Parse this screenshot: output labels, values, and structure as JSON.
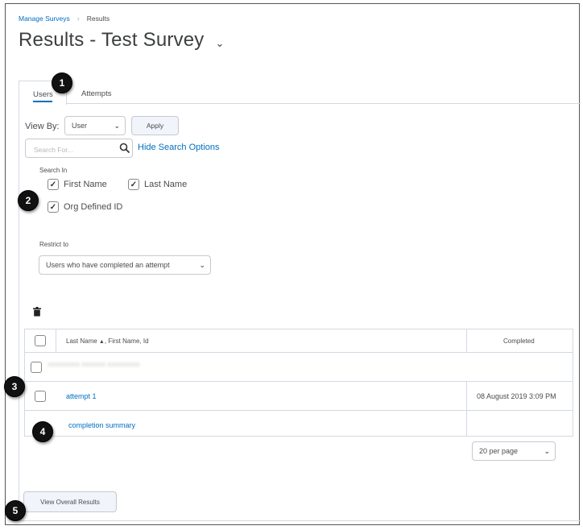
{
  "breadcrumb": {
    "parent": "Manage Surveys",
    "separator": "›",
    "current": "Results"
  },
  "page_title": "Results - Test Survey",
  "tabs": [
    {
      "label": "Users",
      "active": true
    },
    {
      "label": "Attempts",
      "active": false
    }
  ],
  "view_by": {
    "label": "View By:",
    "selected": "User",
    "apply_label": "Apply"
  },
  "search": {
    "placeholder": "Search For...",
    "hide_options_label": "Hide Search Options"
  },
  "search_in": {
    "label": "Search In",
    "options": [
      {
        "label": "First Name",
        "checked": true
      },
      {
        "label": "Last Name",
        "checked": true
      },
      {
        "label": "Org Defined ID",
        "checked": true
      }
    ]
  },
  "restrict": {
    "label": "Restrict to",
    "selected": "Users who have completed an attempt"
  },
  "table": {
    "col_last_name": "Last Name",
    "sort_indicator": "▲",
    "col_rest": ", First Name, Id",
    "col_completed": "Completed",
    "rows": [
      {
        "name": "XXXXXXXX XXXXXX XXXXXXXX",
        "completed": ""
      },
      {
        "name": "attempt 1",
        "completed": "08 August 2019 3:09 PM"
      },
      {
        "name": "completion summary",
        "completed": ""
      }
    ]
  },
  "pagination": {
    "per_page": "20 per page"
  },
  "overall_button_label": "View Overall Results",
  "badges": [
    "1",
    "2",
    "3",
    "4",
    "5"
  ],
  "colors": {
    "link": "#006fbf",
    "text": "#494c4e",
    "border": "#d3d9e3"
  }
}
